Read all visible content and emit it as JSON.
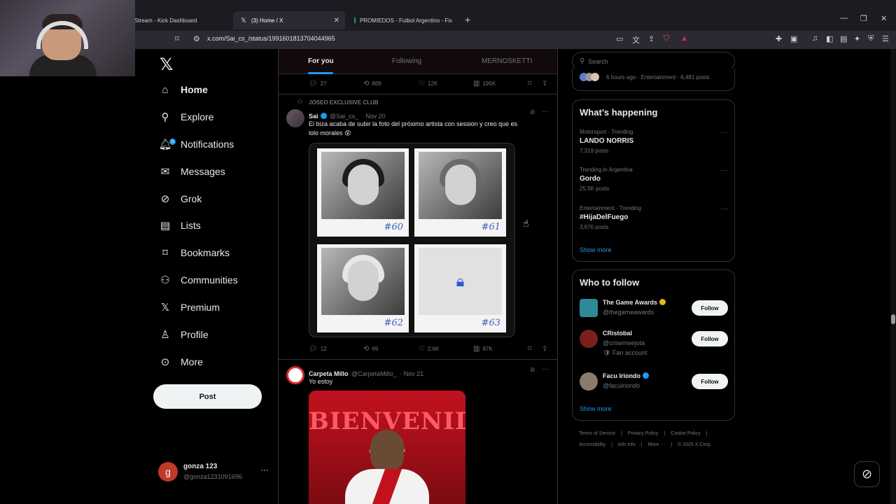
{
  "browser": {
    "tabs": [
      {
        "title": "Stream - Kick Dashboard"
      },
      {
        "title": "(3) Home / X"
      },
      {
        "title": "PROMIEDOS - Futbol Argentino - Fix"
      }
    ],
    "url": "x.com/Sai_cs_/status/1991601813704044965"
  },
  "nav": {
    "items": [
      {
        "label": "Home",
        "icon": "home-icon"
      },
      {
        "label": "Explore",
        "icon": "search-icon"
      },
      {
        "label": "Notifications",
        "icon": "bell-icon",
        "badge": "3"
      },
      {
        "label": "Messages",
        "icon": "mail-icon"
      },
      {
        "label": "Grok",
        "icon": "grok-icon"
      },
      {
        "label": "Lists",
        "icon": "list-icon"
      },
      {
        "label": "Bookmarks",
        "icon": "bookmark-icon"
      },
      {
        "label": "Communities",
        "icon": "people-icon"
      },
      {
        "label": "Premium",
        "icon": "x-icon"
      },
      {
        "label": "Profile",
        "icon": "person-icon"
      },
      {
        "label": "More",
        "icon": "more-circle-icon"
      }
    ],
    "post_label": "Post",
    "account": {
      "initial": "g",
      "name": "gonza 123",
      "handle": "@gonza1231091696"
    }
  },
  "feed": {
    "tabs": [
      "For you",
      "Following",
      "MERNOSKETTI"
    ],
    "prev_actions": {
      "replies": "27",
      "reposts": "869",
      "likes": "12K",
      "views": "195K"
    },
    "tweet1": {
      "community": "JOSEO EXCLUSIVE CLUB",
      "name": "Sai",
      "handle": "@Sai_cs_",
      "date": "· Nov 20",
      "text_line1": "El biza acaba de subir la foto del próximo artista con session y creo que es",
      "text_line2": "lolo morales 😵",
      "photos": [
        "#60",
        "#61",
        "#62",
        "#63"
      ],
      "actions": {
        "replies": "12",
        "reposts": "69",
        "likes": "2.6K",
        "views": "97K"
      }
    },
    "tweet2": {
      "name": "Carpeta Millo",
      "handle": "@CarpetaMillo_",
      "date": "· Nov 21",
      "text": "Yo estoy",
      "image_text": "BIENVENIDO",
      "image_tag": "@ENCUESTADOR"
    }
  },
  "right": {
    "search_placeholder": "Search",
    "top_snippet": "6 hours ago · Entertainment · 6,481 posts",
    "happening": {
      "title": "What’s happening",
      "trends": [
        {
          "context": "Motorsport · Trending",
          "topic": "LANDO NORRIS",
          "posts": "7,319 posts"
        },
        {
          "context": "Trending in Argentina",
          "topic": "Gordo",
          "posts": "25.5K posts"
        },
        {
          "context": "Entertainment · Trending",
          "topic": "#HijaDelFuego",
          "posts": "3,676 posts"
        }
      ],
      "show_more": "Show more"
    },
    "who_to_follow": {
      "title": "Who to follow",
      "accounts": [
        {
          "name": "The Game Awards",
          "handle": "@thegameawards",
          "extra": ""
        },
        {
          "name": "CRistobal",
          "handle": "@crisemeejota",
          "extra": "🛡 Fan account"
        },
        {
          "name": "Facu Iriondo",
          "handle": "@facuiriondo",
          "extra": ""
        }
      ],
      "follow_label": "Follow",
      "show_more": "Show more"
    },
    "footer": {
      "line1": [
        "Terms of Service",
        "Privacy Policy",
        "Cookie Policy"
      ],
      "line2": [
        "Accessibility",
        "Ads info",
        "More ···",
        "© 2025 X Corp."
      ]
    }
  },
  "colors": {
    "accent": "#1d9bf0",
    "background": "#000000",
    "text": "#e7e9ea",
    "muted": "#71767b"
  }
}
